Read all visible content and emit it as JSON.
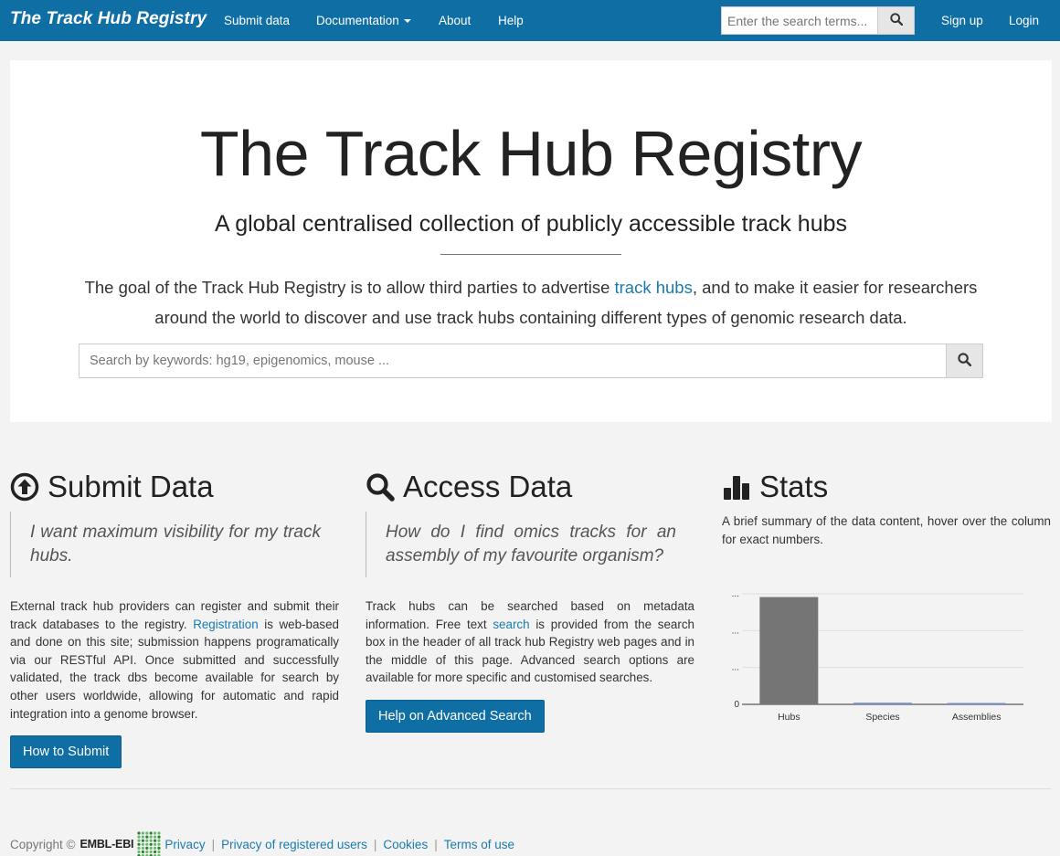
{
  "nav": {
    "brand": "The Track Hub Registry",
    "links": [
      "Submit data",
      "Documentation",
      "About",
      "Help"
    ],
    "search_placeholder": "Enter the search terms...",
    "signup": "Sign up",
    "login": "Login"
  },
  "hero": {
    "title": "The Track Hub Registry",
    "subtitle": "A global centralised collection of publicly accessible track hubs",
    "desc_before": "The goal of the Track Hub Registry is to allow third parties to advertise ",
    "desc_link": "track hubs",
    "desc_after": ", and to make it easier for researchers around the world to discover and use track hubs containing different types of genomic research data.",
    "search_placeholder": "Search by keywords: hg19, epigenomics, mouse ..."
  },
  "submit": {
    "heading": "Submit Data",
    "quote": "I want maximum visibility for my track hubs.",
    "p_before": "External track hub providers can register and submit their track databases to the registry. ",
    "p_link": "Registration",
    "p_after": " is web-based and done on this site; submission happens programatically via our RESTful API. Once submitted and successfully validated, the track dbs become available for search by other users worldwide, allowing for automatic and rapid integration into a genome browser.",
    "button": "How to Submit"
  },
  "access": {
    "heading": "Access Data",
    "quote": "How do I find omics tracks for an assembly of my favourite organism?",
    "p_before": "Track hubs can be searched based on metadata information. Free text ",
    "p_link": "search",
    "p_after": " is provided from the search box in the header of all track hub Registry web pages and in the middle of this page. Advanced search options are available for more specific and customised searches.",
    "button": "Help on Advanced Search"
  },
  "stats": {
    "heading": "Stats",
    "desc": "A brief summary of the data content, hover over the column for exact numbers."
  },
  "chart_data": {
    "type": "bar",
    "categories": [
      "Hubs",
      "Species",
      "Assemblies"
    ],
    "values": [
      0.99,
      0.015,
      0.01
    ],
    "ytick_labels": [
      "0",
      "...",
      "...",
      "..."
    ],
    "ylim": [
      0,
      1.02
    ],
    "bar_colors": [
      "#757575",
      "#6f8fd0",
      "#6f8fd0"
    ]
  },
  "footer": {
    "copyright": "Copyright ©",
    "org": "EMBL-EBI",
    "links": [
      "Privacy",
      "Privacy of registered users",
      "Cookies",
      "Terms of use"
    ],
    "separator": "|"
  },
  "colors": {
    "primary": "#0f6fa5",
    "link": "#1a7bb0"
  },
  "icons": [
    "search-icon",
    "arrow-circle-up-icon",
    "bar-chart-icon",
    "embl-ebi-logo-icon"
  ]
}
